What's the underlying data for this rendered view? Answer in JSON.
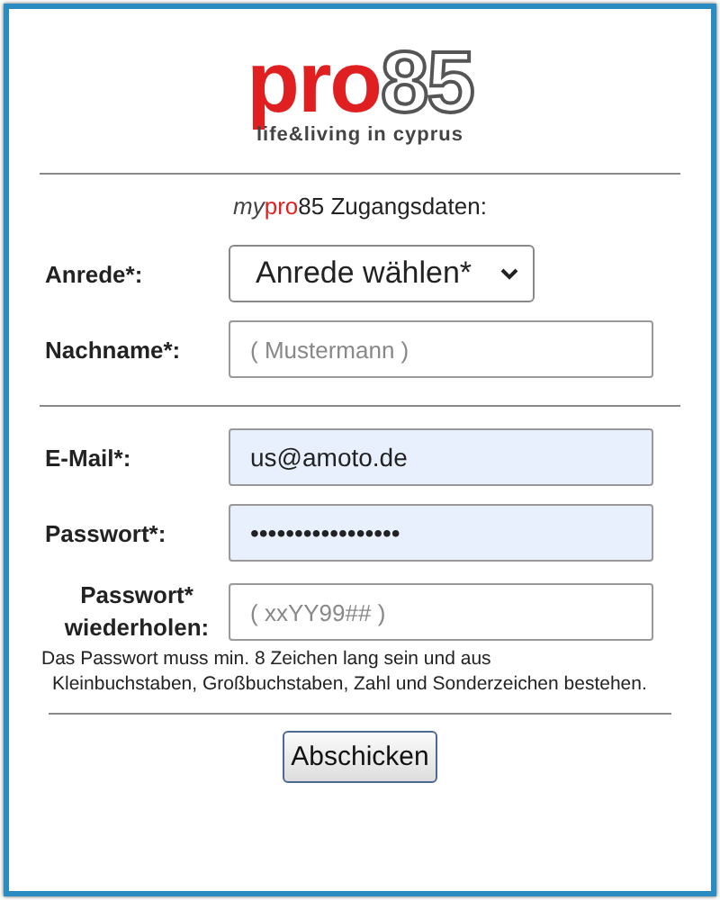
{
  "logo": {
    "brand": "pro",
    "number": "85",
    "tagline": "life&living in cyprus"
  },
  "heading": {
    "prefix": "my",
    "brand": "pro",
    "number": "85",
    "text": "Zugangsdaten:"
  },
  "fields_top": [
    {
      "kind": "select",
      "label": "Anrede*:",
      "value": "Anrede wählen*"
    },
    {
      "kind": "input",
      "label": "Nachname*:",
      "placeholder": "( Mustermann )",
      "autofilled": false
    }
  ],
  "fields_bottom": [
    {
      "kind": "input",
      "label": "E-Mail*:",
      "value": "us@amoto.de",
      "autofilled": true
    },
    {
      "kind": "input",
      "label": "Passwort*:",
      "value": "•••••••••••••••••",
      "autofilled": true
    },
    {
      "kind": "input",
      "label": "Passwort* wiederholen:",
      "placeholder": "( xxYY99## )",
      "autofilled": false
    }
  ],
  "note": [
    "Das Passwort muss min. 8 Zeichen lang sein und aus",
    "Kleinbuchstaben, Großbuchstaben, Zahl und Sonderzeichen bestehen."
  ],
  "submit": "Abschicken"
}
